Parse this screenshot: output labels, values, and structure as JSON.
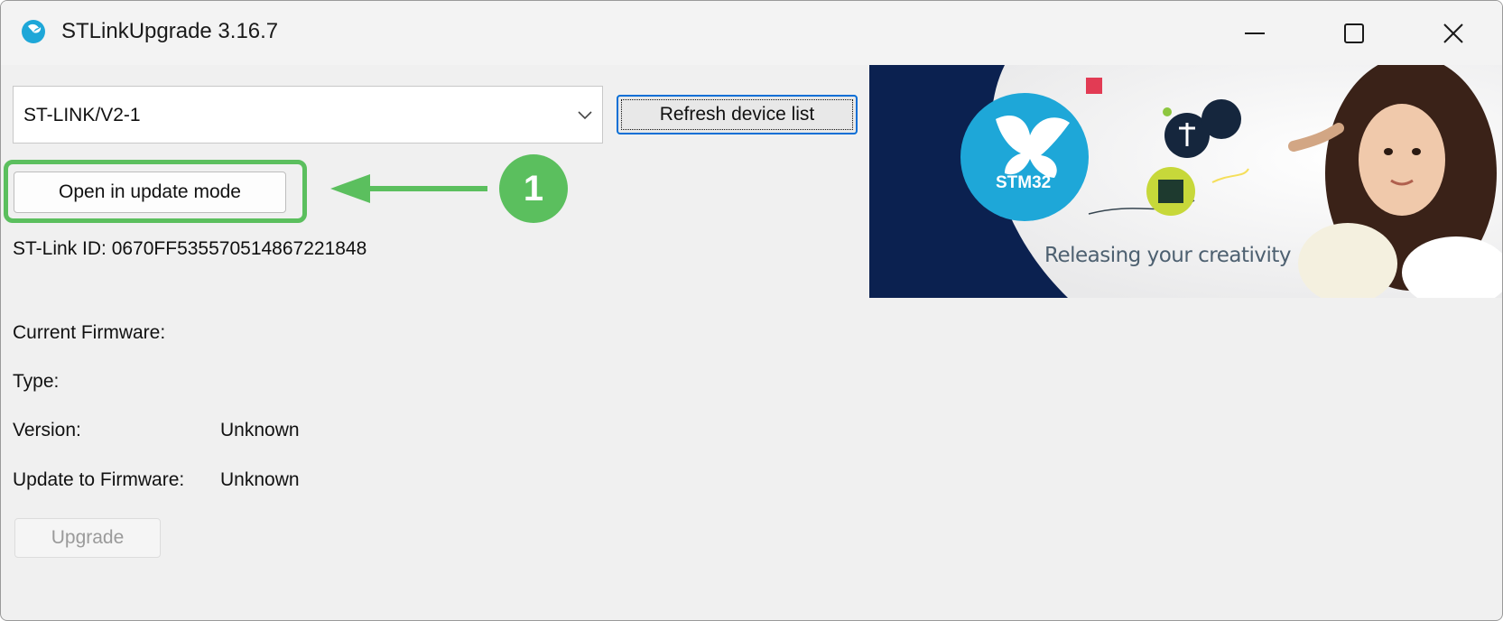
{
  "window": {
    "title": "STLinkUpgrade 3.16.7"
  },
  "device": {
    "selected": "ST-LINK/V2-1",
    "refresh_label": "Refresh device list",
    "open_update_label": "Open in update mode",
    "id_text": "ST-Link ID: 0670FF535570514867221848"
  },
  "annotation": {
    "step_number": "1",
    "color": "#5bbf5e"
  },
  "info": {
    "current_firmware_label": "Current Firmware:",
    "type_label": "Type:",
    "version_label": "Version:",
    "version_value": "Unknown",
    "update_to_label": "Update to Firmware:",
    "update_to_value": "Unknown"
  },
  "actions": {
    "upgrade_label": "Upgrade"
  },
  "banner": {
    "logo_text": "STM32",
    "tagline": "Releasing your creativity"
  },
  "colors": {
    "accent": "#0a6fd6",
    "banner_navy": "#0b2150",
    "logo_blue": "#1ea7d8"
  }
}
